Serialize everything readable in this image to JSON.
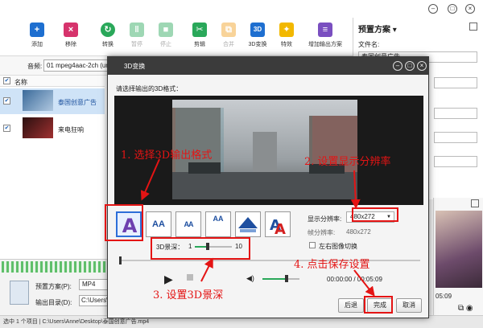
{
  "toolbar": {
    "add": "添加",
    "remove": "移除",
    "convert": "转换",
    "pause": "暂停",
    "stop": "停止",
    "cut": "剪辑",
    "merge": "合并",
    "threed": "3D变换",
    "effects": "特效",
    "add_output": "增加输出方案",
    "threed_icon_text": "3D"
  },
  "preset": {
    "title": "预置方案",
    "file_name_label": "文件名:",
    "file_name_value": "泰国创意广告"
  },
  "audio": {
    "label": "音频:",
    "value": "01 mpeg4aac-2ch (und)"
  },
  "list": {
    "header": "名称",
    "items": [
      {
        "name": "泰国创意广告",
        "checked": "✔"
      },
      {
        "name": "来电狂响",
        "checked": "✔"
      }
    ]
  },
  "bottom": {
    "preset_label": "预置方案(P):",
    "preset_value": "MP4",
    "output_label": "输出目录(D):",
    "output_value": "C:\\Users\\Anne\\"
  },
  "status": {
    "text": "选中 1 个项目 | C:\\Users\\Anne\\Desktop\\泰国创意广告.mp4"
  },
  "preview": {
    "time": "05:09"
  },
  "dialog": {
    "title": "3D变换",
    "prompt": "请选择输出的3D格式：",
    "formats": [
      "AA",
      "AA",
      "AA",
      "AA",
      "AA",
      "A"
    ],
    "display_res_label": "显示分辨率:",
    "display_res_value": "480x272",
    "frame_res_label": "帧分辨率:",
    "frame_res_value": "480x272",
    "swap_label": "左右图像切换",
    "depth_label": "3D景深：",
    "depth_min": "1",
    "depth_max": "10",
    "depth_value": 0.35,
    "progress_value": 0,
    "volume_value": 0.65,
    "time": "00:00:00 / 00:05:09",
    "back": "后退",
    "finish": "完成",
    "cancel": "取消"
  },
  "annotations": {
    "step1": "1. 选择3D输出格式",
    "step2": "2. 设置显示分辨率",
    "step3": "3. 设置3D景深",
    "step4": "4. 点击保存设置",
    "color": "#e41414"
  },
  "colors": {
    "accent_blue": "#1e6fd0",
    "dialog_title": "#3b3b3b",
    "green": "#2aa85a"
  }
}
